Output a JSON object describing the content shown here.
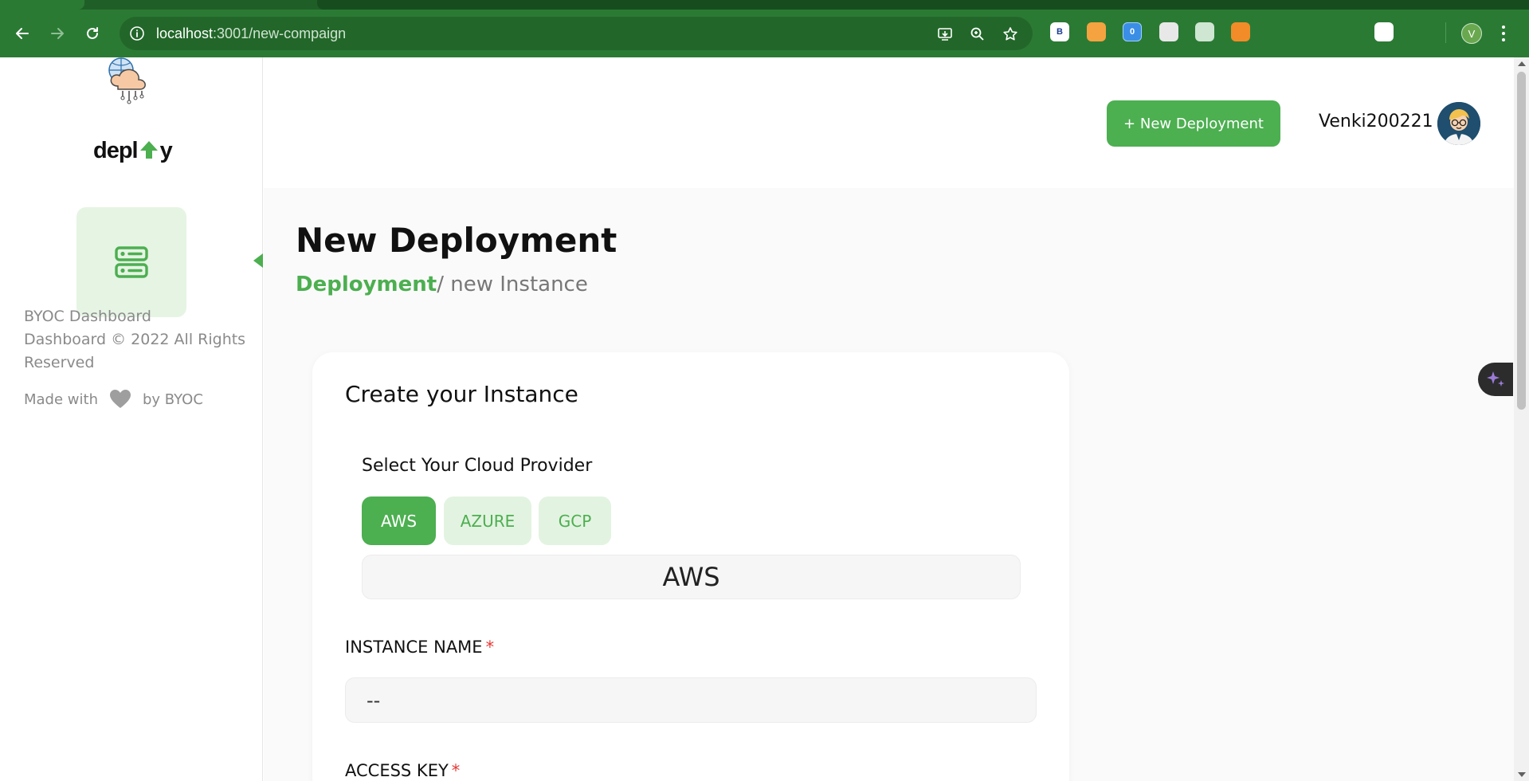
{
  "browser": {
    "url_host": "localhost",
    "url_path": ":3001/new-compaign",
    "profile_initial": "V",
    "extensions": [
      {
        "name": "b-extension-icon",
        "label": "B",
        "bg": "#ffffff",
        "fg": "#1a3d8f"
      },
      {
        "name": "palette-extension-icon",
        "label": "",
        "bg": "#f4a340",
        "fg": "#ffffff"
      },
      {
        "name": "blue-extension-icon",
        "label": "0",
        "bg": "#3a8ee6",
        "fg": "#ffffff"
      },
      {
        "name": "mail-extension-icon",
        "label": "",
        "bg": "#e8e8e8",
        "fg": "#555555"
      },
      {
        "name": "robot-extension-icon",
        "label": "",
        "bg": "#cfe6d2",
        "fg": "#2b7a34"
      },
      {
        "name": "moon-extension-icon",
        "label": "",
        "bg": "#f28c28",
        "fg": "#333333"
      },
      {
        "name": "diamond-extension-icon",
        "label": "",
        "bg": "#2b7a34",
        "fg": "#2f8cf0"
      },
      {
        "name": "play-extension-icon",
        "label": "",
        "bg": "#2b7a34",
        "fg": "#f5a623"
      },
      {
        "name": "sparkle-extension-icon",
        "label": "",
        "bg": "#2b7a34",
        "fg": "#cfe3d1"
      },
      {
        "name": "helix-extension-icon",
        "label": "",
        "bg": "#ffffff",
        "fg": "#3a66d8"
      },
      {
        "name": "puzzle-extension-icon",
        "label": "",
        "bg": "#2b7a34",
        "fg": "#ffffff"
      }
    ]
  },
  "sidebar": {
    "brand": "depl",
    "brand_tail": "y",
    "footer_lines": [
      "BYOC Dashboard",
      "Dashboard © 2022 All Rights",
      "Reserved"
    ],
    "made_with": "Made with",
    "made_by": "by BYOC"
  },
  "header": {
    "new_deployment_label": "+ New Deployment",
    "username": "Venki200221"
  },
  "page": {
    "title": "New Deployment",
    "breadcrumb_active": "Deployment",
    "breadcrumb_rest": "/ new Instance"
  },
  "form": {
    "card_title": "Create your Instance",
    "provider_label": "Select Your Cloud Provider",
    "providers": [
      "AWS",
      "AZURE",
      "GCP"
    ],
    "selected_provider": "AWS",
    "instance_name_label": "INSTANCE NAME",
    "instance_name_value": "--",
    "access_key_label": "ACCESS KEY",
    "required_mark": "*"
  },
  "colors": {
    "accent": "#4caf50",
    "chrome": "#2b7a34",
    "required": "#e53935"
  }
}
